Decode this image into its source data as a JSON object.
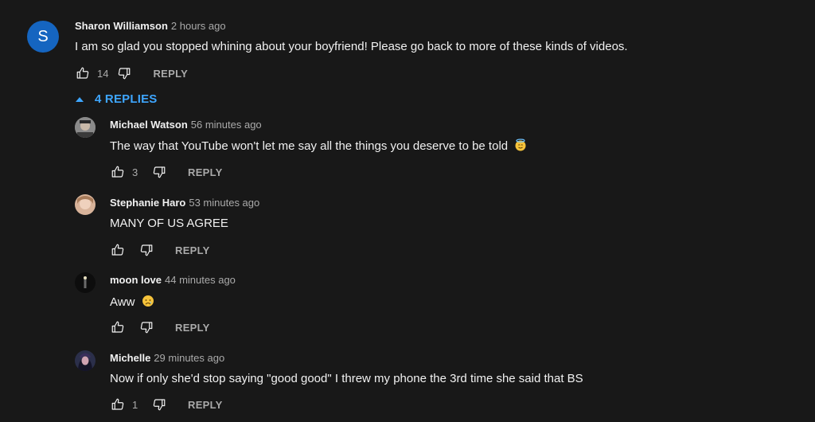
{
  "top_comment": {
    "avatar_letter": "S",
    "avatar_color": "#1565c0",
    "author": "Sharon Williamson",
    "time": "2 hours ago",
    "text": "I am so glad you stopped whining about your boyfriend! Please go back to more of these kinds of videos.",
    "likes": "14",
    "reply_label": "REPLY"
  },
  "replies_toggle": {
    "label": "4 REPLIES",
    "color": "#3ea6ff"
  },
  "replies": [
    {
      "author": "Michael Watson",
      "time": "56 minutes ago",
      "text": "The way that YouTube won't let me say all the things you deserve to be told",
      "emoji": "innocent-face",
      "likes": "3",
      "reply_label": "REPLY"
    },
    {
      "author": "Stephanie Haro",
      "time": "53 minutes ago",
      "text": "MANY OF US AGREE",
      "likes": "",
      "reply_label": "REPLY"
    },
    {
      "author": "moon love",
      "time": "44 minutes ago",
      "text": "Aww",
      "emoji": "sad-face",
      "likes": "",
      "reply_label": "REPLY"
    },
    {
      "author": "Michelle",
      "time": "29 minutes ago",
      "text": "Now if only she'd stop saying \"good good\" I threw my phone the 3rd time she said that BS",
      "likes": "1",
      "reply_label": "REPLY"
    }
  ]
}
